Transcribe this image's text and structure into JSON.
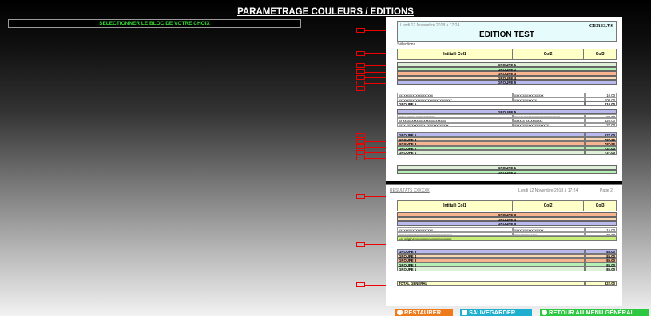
{
  "page_title": "PARAMETRAGE COULEURS / EDITIONS",
  "select_block_label": "SELECTIONNER LE BLOC DE VOTRE CHOIX",
  "colors": {
    "groupe1": "#dff0d8",
    "groupe2": "#b4f0b4",
    "groupe3": "#f8b38f",
    "groupe4": "#fcd8b4",
    "groupe5": "#b9b9ee",
    "header": "#ffffc8",
    "lot": "#c8f078",
    "total": "#ffffc8",
    "arrow": "#e00000"
  },
  "document1": {
    "date": "Lundi 12 Novembre 2018 à 17:24",
    "company": "CERELYS",
    "title": "EDITION TEST",
    "selections": "Sélections ...",
    "columns": [
      "Intitulé Col1",
      "Col2",
      "Col3"
    ],
    "groups_top": [
      "GROUPE 1",
      "GROUPE 2",
      "GROUPE 3",
      "GROUPE 4",
      "GROUPE 5"
    ],
    "block1_rows": [
      [
        "xxxxxxxxxxxxxxxxxxxx",
        "xxxxxxxxxxxxxxxxx",
        "10.00"
      ],
      [
        "xxxxxxxxxxxxxxxxxxxxxxxxxxxxxxx",
        "xxxxxxxxxxxxx",
        "100.00"
      ]
    ],
    "block1_total": [
      "GROUPE 5",
      "110.00"
    ],
    "block2_header": "GROUPE 5",
    "block2_rows": [
      [
        "xxxx xxxxx xxxxxxxxxxx",
        "xxxxx xxxxxxxxxxxxxxxxxxxxx",
        "80.00"
      ],
      [
        "xx xxxxxxxxxxxxxxxxxxxxxxxxx",
        "xxxxxx xxxxxxxxxx",
        "520.00"
      ],
      [
        "xxxx xxxxxxxxxxx xxxxxxxxxxxxx",
        "xxxxxxxxxxxxxxxxxxxx",
        "27.00"
      ]
    ],
    "subtotals": [
      [
        "GROUPE 5",
        "627.00"
      ],
      [
        "GROUPE 4",
        "737.00"
      ],
      [
        "GROUPE 3",
        "737.00"
      ],
      [
        "GROUPE 2",
        "737.00"
      ],
      [
        "GROUPE 1",
        "737.00"
      ]
    ],
    "groups_bottom": [
      "GROUPE 1",
      "GROUPE 2"
    ]
  },
  "document2": {
    "results_label": "RÉSULTATS XXXXXX",
    "date": "Lundi 12 Novembre 2018 à 17:24",
    "page": "Page 2",
    "columns": [
      "Intitulé Col1",
      "Col2",
      "Col3"
    ],
    "groups_top": [
      "GROUPE 3",
      "GROUPE 4",
      "GROUPE 5"
    ],
    "rows": [
      [
        "xxxxxxxxxxxxxxxxxxxx",
        "xxxxxxxxxxxxxxxxx",
        "15.00"
      ],
      [
        "xxxxxxxxxxxxxxxxxxxxxxxxxxxxxxx",
        "xxxxxxxxxxxxx",
        "70.00"
      ]
    ],
    "lot_label": "Lot origine xxxxxxxxxxxxxxxxxxxxx",
    "subtotals": [
      [
        "GROUPE 5",
        "85.00"
      ],
      [
        "GROUPE 4",
        "85.00"
      ],
      [
        "GROUPE 3",
        "85.00"
      ],
      [
        "GROUPE 2",
        "85.00"
      ],
      [
        "GROUPE 1",
        "85.00"
      ]
    ],
    "grand_total": [
      "TOTAL GÉNÉRAL",
      "822.00"
    ]
  },
  "buttons": {
    "restore": "RESTAURER",
    "save": "SAUVEGARDER",
    "back": "RETOUR AU MENU GÉNÉRAL"
  }
}
